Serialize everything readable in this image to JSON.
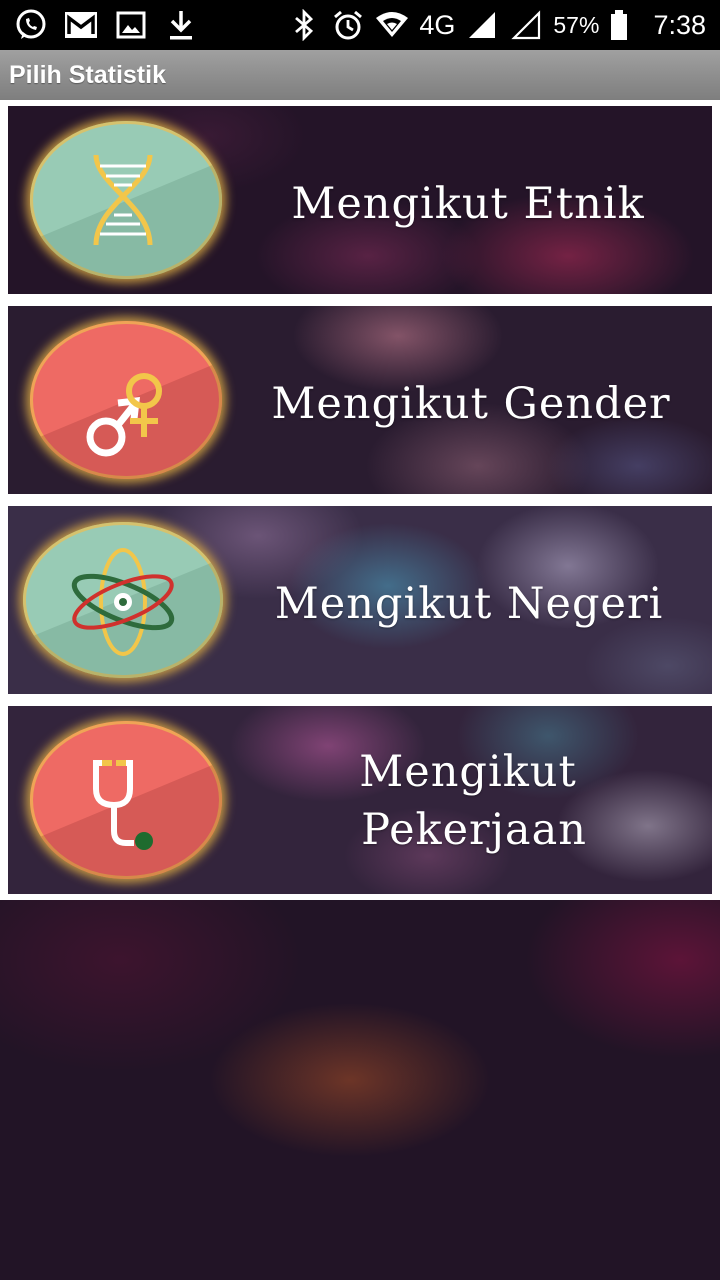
{
  "status_bar": {
    "icons": [
      "whatsapp-icon",
      "gmail-icon",
      "image-icon",
      "download-icon",
      "bluetooth-icon",
      "alarm-icon",
      "wifi-icon",
      "signal-icon",
      "signal-empty-icon",
      "battery-icon"
    ],
    "network": "4G",
    "battery": "57%",
    "time": "7:38"
  },
  "header": {
    "title": "Pilih Statistik"
  },
  "menu": {
    "items": [
      {
        "label": "Mengikut Etnik",
        "icon": "dna-icon",
        "icon_bg": "#98cbb5"
      },
      {
        "label": "Mengikut Gender",
        "icon": "gender-icon",
        "icon_bg": "#ee6a64"
      },
      {
        "label": "Mengikut Negeri",
        "icon": "atom-icon",
        "icon_bg": "#98cbb5"
      },
      {
        "label_line1": "Mengikut",
        "label_line2": "Pekerjaan",
        "icon": "stethoscope-icon",
        "icon_bg": "#ee6a64"
      }
    ]
  },
  "colors": {
    "status_bar_bg": "#000000",
    "title_bar_bg": "#8e8e8e",
    "background": "#221426"
  }
}
